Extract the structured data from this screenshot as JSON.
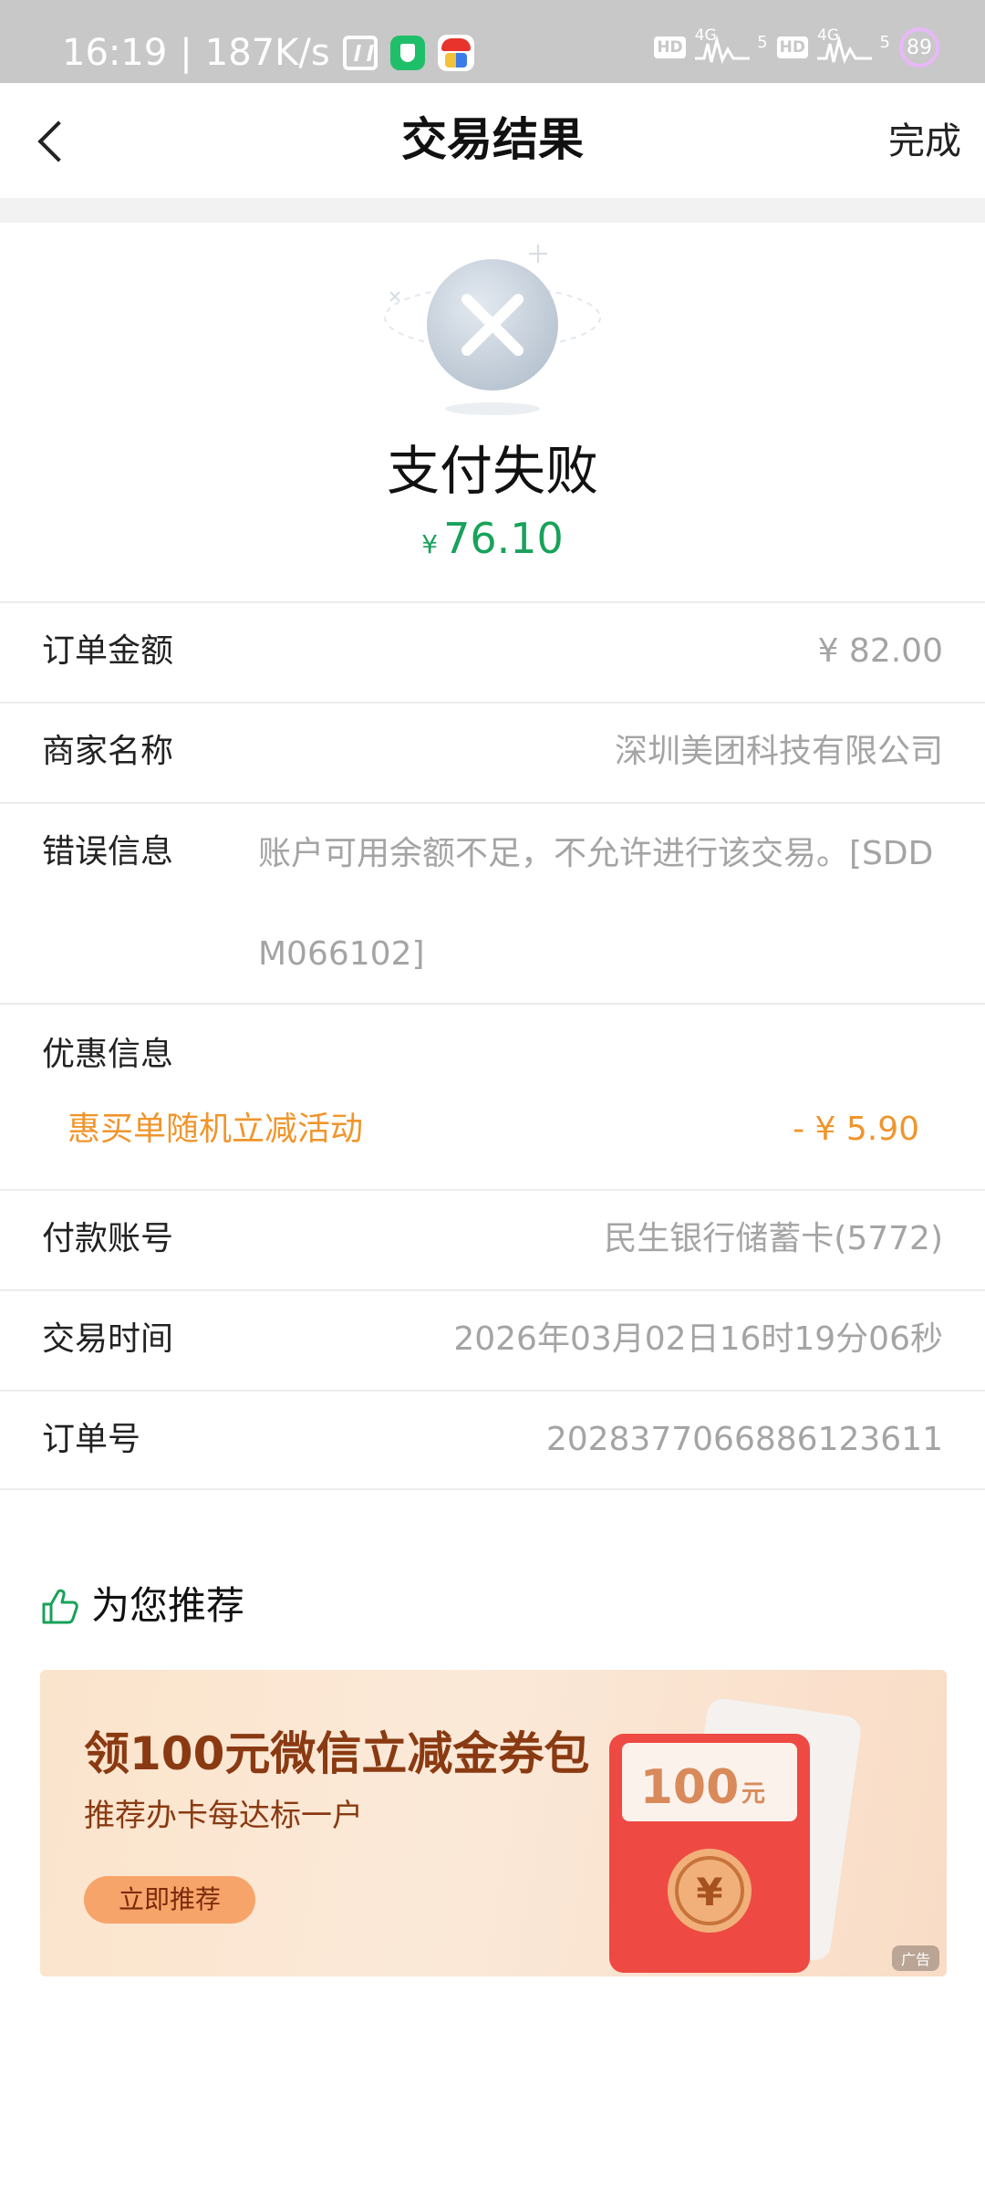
{
  "status_bar": {
    "time": "16:19",
    "speed": "187K/s",
    "hd_1": "HD",
    "net_1": "4G",
    "sig_1": "5",
    "hd_2": "HD",
    "net_2": "4G",
    "sig_2": "5",
    "battery": "89",
    "icons": [
      "nfc-icon",
      "app-shield-icon",
      "app-clown-icon"
    ]
  },
  "nav": {
    "title": "交易结果",
    "done_label": "完成",
    "back_icon": "chevron-left-icon"
  },
  "result": {
    "icon": "close-circle-icon",
    "title": "支付失败",
    "currency": "¥",
    "amount": "76.10",
    "accent": "#18a25a"
  },
  "details": {
    "order_amount": {
      "label": "订单金额",
      "value": "¥ 82.00"
    },
    "merchant": {
      "label": "商家名称",
      "value": "深圳美团科技有限公司"
    },
    "error": {
      "label": "错误信息",
      "value": "账户可用余额不足，不允许进行该交易。[SDDM066102]"
    },
    "promo": {
      "label": "优惠信息",
      "name": "惠买单随机立减活动",
      "value": "- ¥ 5.90",
      "color": "#f0952c"
    },
    "account": {
      "label": "付款账号",
      "value": "民生银行储蓄卡(5772)"
    },
    "time": {
      "label": "交易时间",
      "value": "2026年03月02日16时19分06秒"
    },
    "order_no": {
      "label": "订单号",
      "value": "2028377066886123611"
    }
  },
  "recommend": {
    "icon": "thumbs-up-icon",
    "title": "为您推荐",
    "ad": {
      "title": "领100元微信立减金券包",
      "subtitle": "推荐办卡每达标一户",
      "cta": "立即推荐",
      "card_amount": "100",
      "card_unit": "元",
      "tag": "广告"
    }
  }
}
